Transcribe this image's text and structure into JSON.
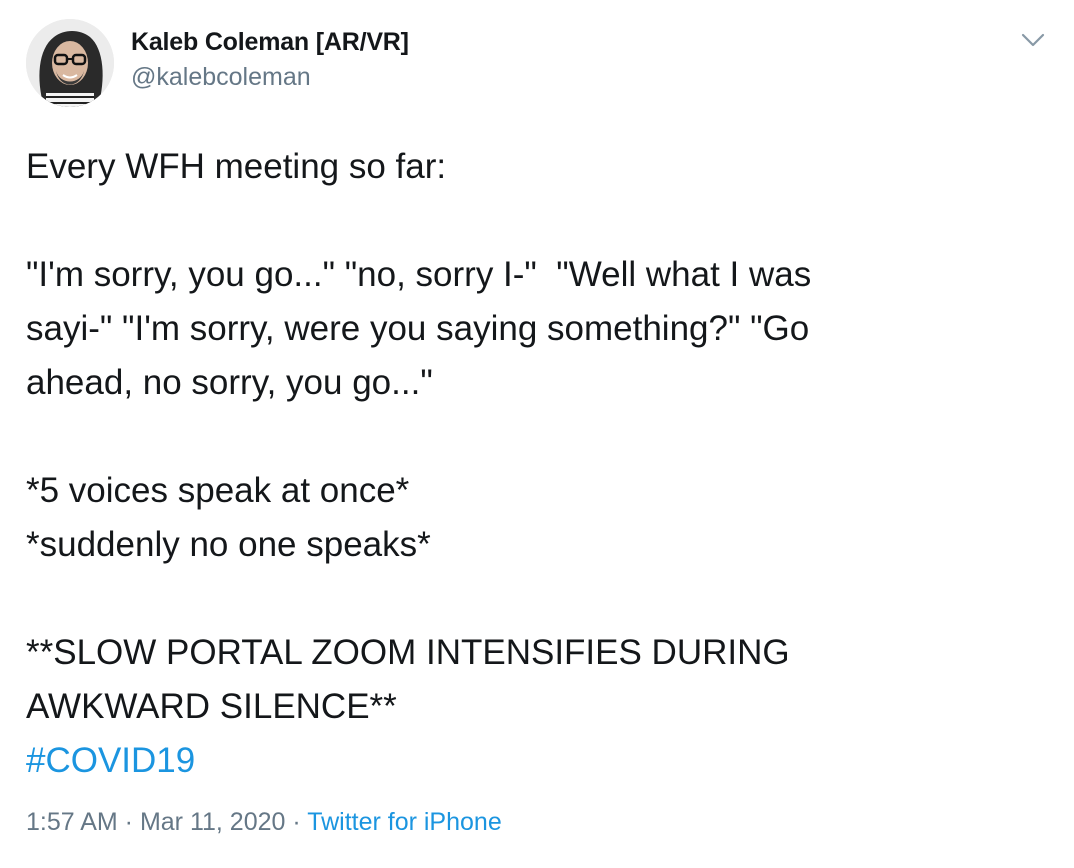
{
  "author": {
    "display_name": "Kaleb Coleman [AR/VR]",
    "handle": "@kalebcoleman"
  },
  "tweet": {
    "lines": [
      "Every WFH meeting so far:",
      "",
      "\"I'm sorry, you go...\" \"no, sorry I-\"  \"Well what I was",
      "sayi-\" \"I'm sorry, were you saying something?\" \"Go",
      "ahead, no sorry, you go...\"",
      "",
      "*5 voices speak at once*",
      "*suddenly no one speaks*",
      "",
      "**SLOW PORTAL ZOOM INTENSIFIES DURING",
      "AWKWARD SILENCE**"
    ],
    "hashtag": "#COVID19"
  },
  "meta": {
    "time": "1:57 AM",
    "separator": " · ",
    "date": "Mar 11, 2020",
    "source": "Twitter for iPhone"
  },
  "icons": {
    "more": "chevron-down-icon",
    "avatar": "avatar"
  },
  "colors": {
    "link": "#1b95e0",
    "secondary_text": "#657786",
    "primary_text": "#14171a",
    "background": "#ffffff"
  }
}
